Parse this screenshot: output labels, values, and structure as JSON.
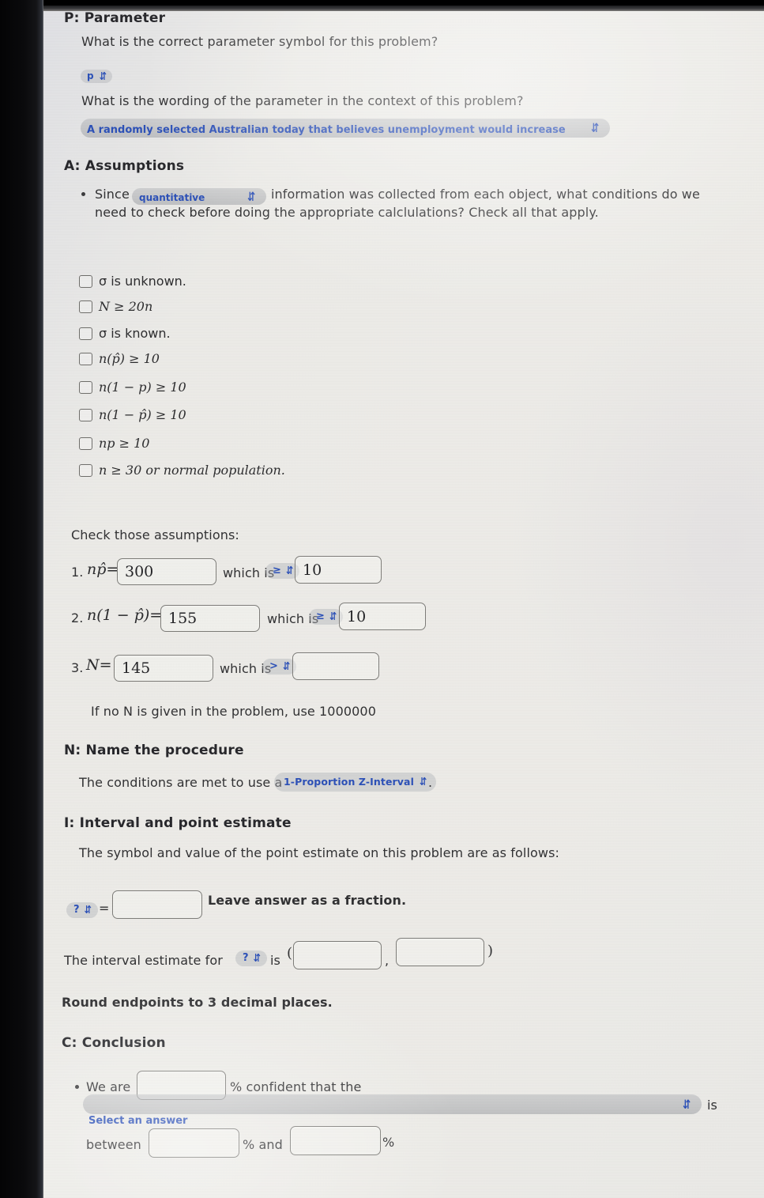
{
  "sections": {
    "parameter": {
      "heading": "P: Parameter",
      "q1": "What is the correct parameter symbol for this problem?",
      "symbol_dropdown": "p",
      "q2": "What is the wording of the parameter in the context of this problem?",
      "wording_dropdown": "A randomly selected Australian today that believes unemployment would increase"
    },
    "assumptions": {
      "heading": "A: Assumptions",
      "since_prefix": "Since",
      "data_type_dropdown": "quantitative",
      "since_suffix": "information was collected from each object, what conditions do we",
      "since_line2": "need to check before doing the appropriate calclulations? Check all that apply.",
      "options": [
        {
          "id": "sigma-unknown",
          "label": "σ is unknown.",
          "checked": false,
          "math": false
        },
        {
          "id": "n-ge-20n",
          "label": "N ≥ 20n",
          "checked": false,
          "math": true
        },
        {
          "id": "sigma-known",
          "label": "σ is known.",
          "checked": false,
          "math": false
        },
        {
          "id": "n-phat-ge-10",
          "label": "n(p̂) ≥ 10",
          "checked": false,
          "math": true
        },
        {
          "id": "n-1-minus-p-ge-10",
          "label": "n(1 − p) ≥ 10",
          "checked": false,
          "math": true
        },
        {
          "id": "n-1-minus-phat-ge-10",
          "label": "n(1 − p̂) ≥ 10",
          "checked": false,
          "math": true
        },
        {
          "id": "np-ge-10",
          "label": "np ≥ 10",
          "checked": false,
          "math": true
        },
        {
          "id": "n-ge-30",
          "label": "n ≥ 30 or normal population.",
          "checked": false,
          "math": true
        }
      ],
      "check_heading": "Check those assumptions:",
      "checks": [
        {
          "number": "1.",
          "symbol": "np̂=",
          "value": "300",
          "which_is": "which is",
          "operator": "≥",
          "compare": "10"
        },
        {
          "number": "2.",
          "symbol": "n(1 − p̂)=",
          "value": "155",
          "which_is": "which is",
          "operator": "≥",
          "compare": "10"
        },
        {
          "number": "3.",
          "symbol": "N=",
          "value": "145",
          "which_is": "which is",
          "operator": ">",
          "compare": ""
        }
      ],
      "no_n_note": "If no N is given in the problem, use 1000000"
    },
    "name_procedure": {
      "heading": "N: Name the procedure",
      "text_prefix": "The conditions are met to use a",
      "procedure_dropdown": "1-Proportion Z-Interval",
      "text_suffix": "."
    },
    "interval": {
      "heading": "I: Interval and point estimate",
      "intro": "The symbol and value of the point estimate on this problem are as follows:",
      "symbol_dropdown": "?",
      "equals": "=",
      "point_estimate_value": "",
      "fraction_note": "Leave answer as a fraction.",
      "interval_prefix": "The interval estimate for",
      "interval_dropdown": "?",
      "interval_is": "is",
      "open_paren": "(",
      "comma": ",",
      "close_paren": ")",
      "lower_value": "",
      "upper_value": "",
      "round_note": "Round endpoints to 3 decimal places."
    },
    "conclusion": {
      "heading": "C: Conclusion",
      "we_are": "We are",
      "confidence_value": "",
      "percent_confident": "% confident that the",
      "answer_dropdown_placeholder": "Select an answer",
      "is_word": "is",
      "between": "between",
      "lower_value": "",
      "percent_and": "% and",
      "upper_value": "",
      "percent_sign": "%"
    }
  },
  "icons": {
    "chevron": "⌃⌄",
    "chevron_updown": "⇅"
  },
  "colors": {
    "dropdown_text": "#2b50b8",
    "dropdown_bg": "#b0b2b7",
    "page_bg": "#edece8",
    "text": "#2a2a2c"
  }
}
